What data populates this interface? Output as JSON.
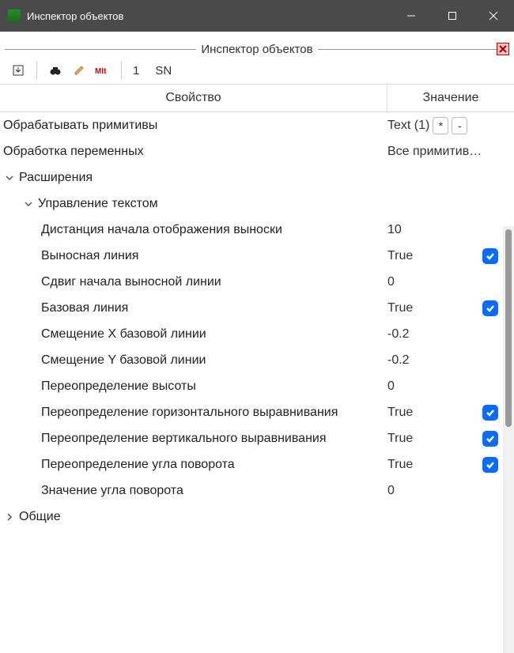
{
  "window": {
    "title": "Инспектор объектов"
  },
  "panel": {
    "title": "Инспектор объектов"
  },
  "toolbar": {
    "count": "1",
    "sn": "SN"
  },
  "columns": {
    "property": "Свойство",
    "value": "Значение"
  },
  "rows": {
    "r0": {
      "name": "Обрабатывать примитивы",
      "value": "Text (1)",
      "btn1": "*",
      "btn2": "-"
    },
    "r1": {
      "name": "Обработка переменных",
      "value": "Все примитив…"
    },
    "r2": {
      "name": "Расширения"
    },
    "r3": {
      "name": "Управление текстом"
    },
    "r4": {
      "name": "Дистанция начала отображения выноски",
      "value": "10"
    },
    "r5": {
      "name": "Выносная линия",
      "value": "True"
    },
    "r6": {
      "name": "Сдвиг начала выносной линии",
      "value": "0"
    },
    "r7": {
      "name": "Базовая линия",
      "value": "True"
    },
    "r8": {
      "name": "Смещение X базовой линии",
      "value": "-0.2"
    },
    "r9": {
      "name": "Смещение Y базовой линии",
      "value": "-0.2"
    },
    "r10": {
      "name": "Переопределение высоты",
      "value": "0"
    },
    "r11": {
      "name": "Переопределение горизонтального выравнивания",
      "value": "True"
    },
    "r12": {
      "name": "Переопределение вертикального выравнивания",
      "value": "True"
    },
    "r13": {
      "name": "Переопределение угла поворота",
      "value": "True"
    },
    "r14": {
      "name": "Значение угла поворота",
      "value": "0"
    },
    "r15": {
      "name": "Общие"
    }
  }
}
